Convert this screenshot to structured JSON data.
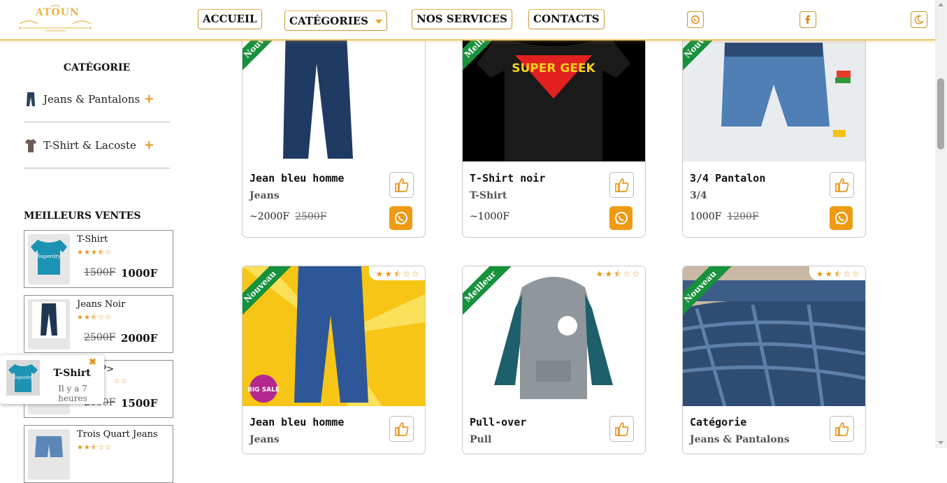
{
  "header": {
    "logo_text": "ATOUN",
    "nav": [
      "ACCUEIL",
      "CATÉGORIES",
      "NOS SERVICES",
      "CONTACTS"
    ]
  },
  "sidebar": {
    "category_title": "CATÉGORIE",
    "categories": [
      {
        "label": "Jeans & Pantalons",
        "icon": "jeans-thumbnail"
      },
      {
        "label": "T-Shirt & Lacoste",
        "icon": "tshirt-thumbnail"
      }
    ],
    "best_title": "MEILLEURS VENTES",
    "best": [
      {
        "name": "T-Shirt",
        "stars": "★★★⯪☆",
        "old": "1500F",
        "new": "1000F"
      },
      {
        "name": "Jeans Noir",
        "stars": "★★⯪☆☆",
        "old": "2500F",
        "new": "2000F"
      },
      {
        "name": "over/P>",
        "stars": "☆☆",
        "old": "2000F",
        "new": "1500F"
      },
      {
        "name": "Trois Quart Jeans",
        "stars": "★★⯪☆☆",
        "old": "",
        "new": ""
      }
    ]
  },
  "toast": {
    "name": "T-Shirt",
    "time": "Il y a 7 heures",
    "close": "✖"
  },
  "products": [
    {
      "name": "Jean bleu homme",
      "category": "Jeans",
      "price": "~2000F",
      "old_price": "2500F",
      "ribbon": "Nouveau",
      "stars": ""
    },
    {
      "name": "T-Shirt noir",
      "category": "T-Shirt",
      "price": "~1000F",
      "old_price": "",
      "ribbon": "Meilleur",
      "stars": ""
    },
    {
      "name": "3/4 Pantalon",
      "category": "3/4",
      "price": "1000F",
      "old_price": "1200F",
      "ribbon": "Nouveau",
      "stars": ""
    },
    {
      "name": "Jean bleu homme",
      "category": "Jeans",
      "price": "",
      "old_price": "",
      "ribbon": "Nouveau",
      "stars": "★★⯪☆☆"
    },
    {
      "name": "Pull-over",
      "category": "Pull",
      "price": "",
      "old_price": "",
      "ribbon": "Meilleur",
      "stars": "★★⯪☆☆"
    },
    {
      "name": "Catégorie",
      "category": "Jeans & Pantalons",
      "price": "",
      "old_price": "",
      "ribbon": "Nouveau",
      "stars": "★★⯪☆☆"
    }
  ],
  "product_images": {
    "2": "BIG SALE",
    "4": "SUPER GEEK"
  },
  "colors": {
    "accent": "#ee9a12",
    "ribbon": "#16913c",
    "border": "#c7962f"
  }
}
